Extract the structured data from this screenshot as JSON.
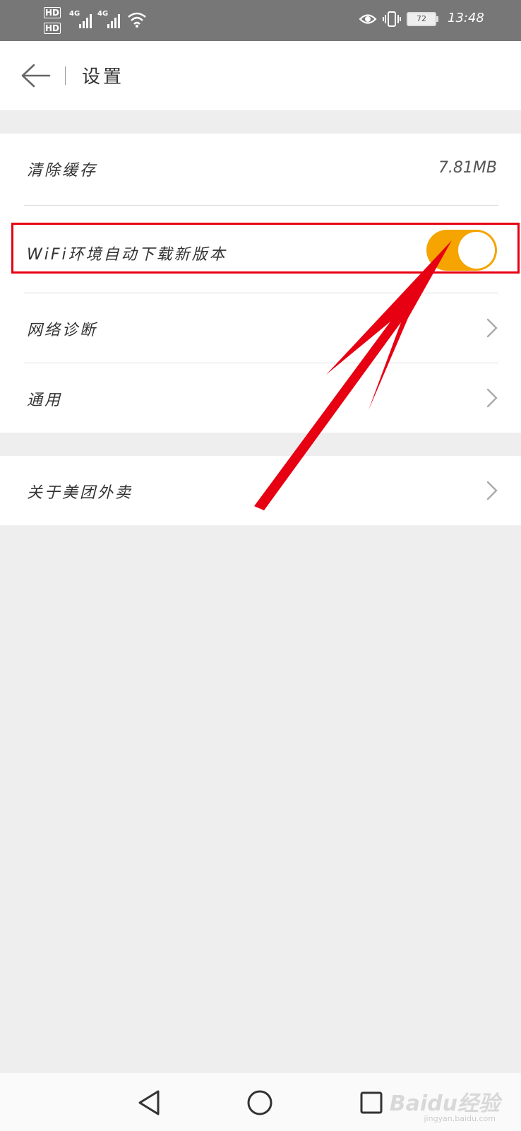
{
  "status_bar": {
    "hd1": "HD",
    "hd2": "HD",
    "network1": "4G",
    "network2": "4G",
    "battery_level": "72",
    "time": "13:48",
    "icons": [
      "wifi-icon",
      "eye-comfort-icon",
      "vibrate-icon",
      "battery-icon"
    ]
  },
  "header": {
    "title": "设置",
    "back_icon": "arrow-left-icon"
  },
  "settings": {
    "clear_cache": {
      "label": "清除缓存",
      "value": "7.81MB"
    },
    "wifi_auto_download": {
      "label": "WiFi环境自动下载新版本",
      "enabled": true
    },
    "network_diagnosis": {
      "label": "网络诊断"
    },
    "general": {
      "label": "通用"
    },
    "about": {
      "label": "关于美团外卖"
    }
  },
  "annotation": {
    "highlight_color": "#e60012",
    "arrow_color": "#e60012"
  },
  "colors": {
    "toggle_on": "#f5a400",
    "status_bar": "#777777",
    "page_bg": "#eeeeee"
  },
  "nav_bar": {
    "buttons": [
      "back-triangle-icon",
      "home-circle-icon",
      "recents-square-icon"
    ]
  },
  "watermark": {
    "brand": "Baidu经验",
    "url": "jingyan.baidu.com"
  }
}
